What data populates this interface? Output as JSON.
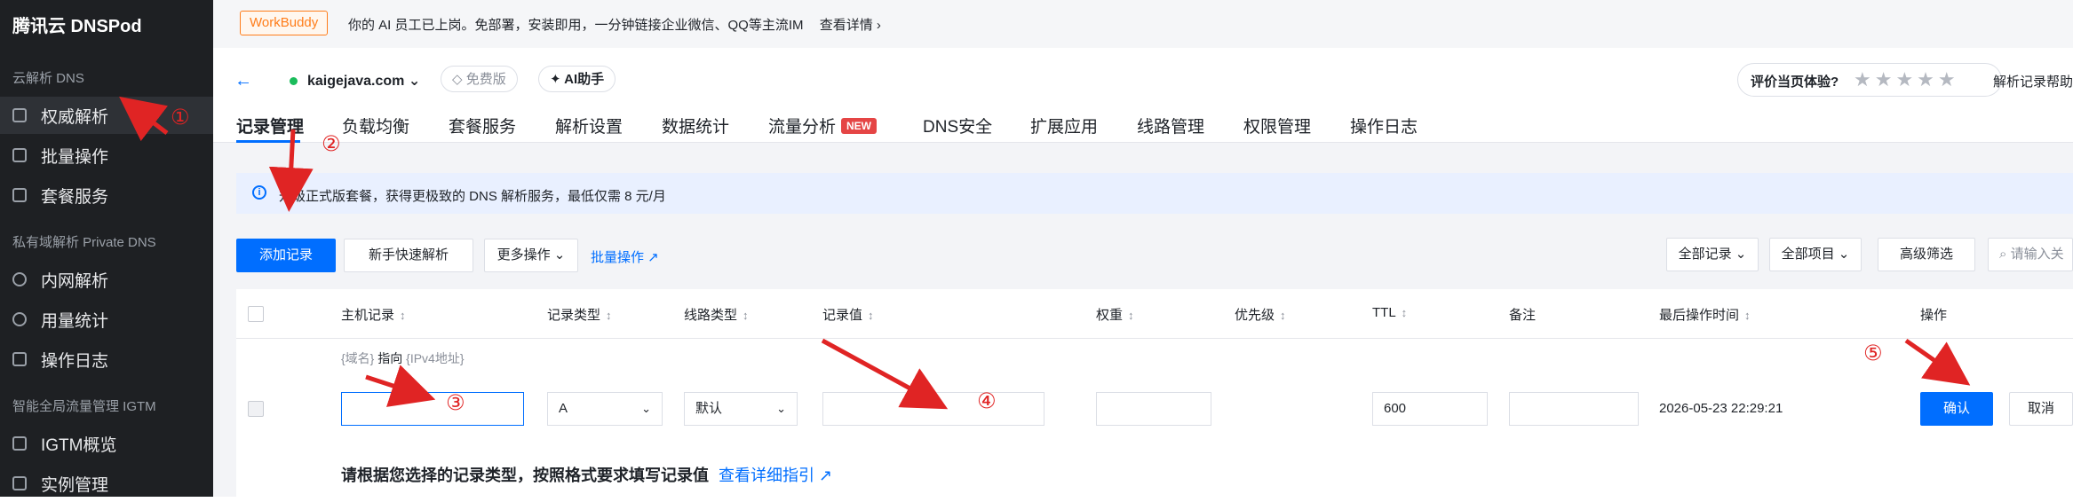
{
  "sidebar": {
    "brand": "腾讯云 DNSPod",
    "group1": "云解析 DNS",
    "group2": "私有域解析 Private DNS",
    "group3": "智能全局流量管理 IGTM",
    "items": [
      {
        "label": "权威解析"
      },
      {
        "label": "批量操作"
      },
      {
        "label": "套餐服务"
      },
      {
        "label": "内网解析"
      },
      {
        "label": "用量统计"
      },
      {
        "label": "操作日志"
      },
      {
        "label": "IGTM概览"
      },
      {
        "label": "实例管理"
      }
    ]
  },
  "banner": {
    "badge": "WorkBuddy",
    "text": "你的 AI 员工已上岗。免部署，安装即用，一分钟链接企业微信、QQ等主流IM",
    "link": "查看详情 ›"
  },
  "subheader": {
    "back": "←",
    "domain": "kaigejava.com ⌄",
    "free": "◇ 免费版",
    "ai": "✦ AI助手",
    "rate_label": "评价当页体验?",
    "stars": "★★★★★",
    "help": "解析记录帮助"
  },
  "tabs": [
    "记录管理",
    "负载均衡",
    "套餐服务",
    "解析设置",
    "数据统计",
    "流量分析",
    "DNS安全",
    "扩展应用",
    "线路管理",
    "权限管理",
    "操作日志"
  ],
  "new_badge": "NEW",
  "info": {
    "icon": "i",
    "text": "升级正式版套餐，获得更极致的 DNS 解析服务，最低仅需 8 元/月"
  },
  "toolbar": {
    "add": "添加记录",
    "quick": "新手快速解析",
    "more": "更多操作 ⌄",
    "batch": "批量操作 ↗",
    "all_records": "全部记录 ⌄",
    "all_items": "全部项目 ⌄",
    "adv": "高级筛选",
    "search_placeholder": "请输入关"
  },
  "table": {
    "headers": [
      "主机记录",
      "记录类型",
      "线路类型",
      "记录值",
      "权重",
      "优先级",
      "TTL",
      "备注",
      "最后操作时间",
      "操作"
    ],
    "sort_icon": "↕",
    "hint_left": "{域名}",
    "hint_mid": "指向",
    "hint_right": "{IPv4地址}",
    "row": {
      "type": "A",
      "line": "默认",
      "ttl": "600",
      "time": "2026-05-23 22:29:21",
      "confirm": "确认",
      "cancel": "取消"
    },
    "footer_tip": "请根据您选择的记录类型，按照格式要求填写记录值",
    "footer_link": "查看详细指引 ↗"
  },
  "annotations": [
    "①",
    "②",
    "③",
    "④",
    "⑤"
  ],
  "colors": {
    "accent": "#006eff",
    "annotation": "#e02424",
    "sidebar_bg": "#1e2023"
  }
}
